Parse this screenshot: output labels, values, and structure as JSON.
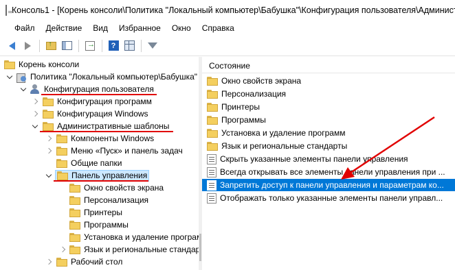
{
  "window": {
    "title": "Консоль1 - [Корень консоли\\Политика \"Локальный компьютер\\Бабушка\"\\Конфигурация пользователя\\Администр"
  },
  "menu": [
    "Файл",
    "Действие",
    "Вид",
    "Избранное",
    "Окно",
    "Справка"
  ],
  "toolbar": {
    "icons": [
      "arrow-left-icon",
      "arrow-right-icon",
      "folder-up-icon",
      "show-hide-tree-icon",
      "export-icon",
      "help-icon",
      "properties-icon",
      "filter-icon"
    ]
  },
  "tree": {
    "root": "Корень консоли",
    "policy": "Политика \"Локальный компьютер\\Бабушка\"",
    "user_config": "Конфигурация пользователя",
    "programs_config": "Конфигурация программ",
    "windows_config": "Конфигурация Windows",
    "admin_templates": "Административные шаблоны",
    "windows_components": "Компоненты Windows",
    "start_menu": "Меню «Пуск» и панель задач",
    "shared_folders": "Общие папки",
    "control_panel": "Панель управления",
    "cp_children": [
      "Окно свойств экрана",
      "Персонализация",
      "Принтеры",
      "Программы",
      "Установка и удаление програм",
      "Язык и региональные стандарт"
    ],
    "desktop": "Рабочий стол"
  },
  "details": {
    "header": "Состояние",
    "folders": [
      "Окно свойств экрана",
      "Персонализация",
      "Принтеры",
      "Программы",
      "Установка и удаление программ",
      "Язык и региональные стандарты"
    ],
    "settings": [
      "Скрыть указанные элементы панели управления",
      "Всегда открывать все элементы панели управления при ...",
      "Запретить доступ к панели управления и параметрам ко...",
      "Отображать только указанные элементы панели управл..."
    ],
    "selected_setting_index": 2
  },
  "colors": {
    "selection": "#0078d7",
    "annotation": "#e10000",
    "tree_selection": "#cce8ff"
  }
}
